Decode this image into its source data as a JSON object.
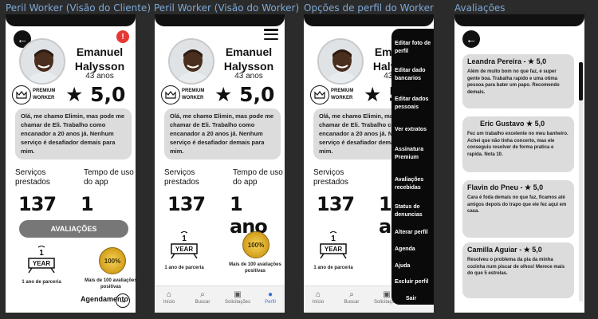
{
  "frame_labels": [
    "Peril Worker (Visão do Cliente)",
    "Peril Worker (Visão do Worker)",
    "Opções de perfil do Worker",
    "Avaliações"
  ],
  "profile": {
    "name_line1": "Emanuel",
    "name_line2": "Halysson",
    "age": "43 anos",
    "premium_line1": "PREMIUM",
    "premium_line2": "WORKER",
    "rating": "★ 5,0",
    "bio": "Olá, me chamo Elimin, mas pode me chamar de Eli. Trabalho como encanador a 20 anos já. Nenhum serviço é desafiador demais para mim.",
    "stats": {
      "services_label": "Serviços prestados",
      "services_value": "137",
      "time_label": "Tempo de uso do app",
      "time_value": "1 ano"
    },
    "badges": {
      "year_label": "1",
      "year_word": "YEAR",
      "year_caption": "1 ano de parceria",
      "hundred_label": "100%",
      "hundred_caption": "Mais de 100 avaliações positivas"
    }
  },
  "client_view": {
    "reviews_button": "AVALIAÇÕES",
    "schedule_label": "Agendamento",
    "arrow_icon": "→"
  },
  "nav": {
    "items": [
      {
        "label": "Início",
        "icon": "⌂"
      },
      {
        "label": "Buscar",
        "icon": "⌕"
      },
      {
        "label": "Solicitações",
        "icon": "▣"
      },
      {
        "label": "Perfil",
        "icon": "●"
      }
    ],
    "active_color": "#3b6fd1"
  },
  "menu": {
    "items": [
      "Editar foto de perfil",
      "Editar dado bancarios",
      "Editar dados pessoais",
      "Ver extratos",
      "Assinatura Premium",
      "Avaliações recebidas",
      "Status de denuncias",
      "Alterar perfil",
      "Agenda",
      "Ajuda",
      "Excluir perfil",
      "Sair"
    ]
  },
  "reviews": [
    {
      "name": "Leandra Pereira",
      "rating": "★ 5,0",
      "text": "Além de muito bom no que faz, é super gente boa. Trabalha rapido e uma otima pessoa para bater um papo. Recomendo demais."
    },
    {
      "name": "Eric Gustavo",
      "rating": "★ 5,0",
      "text": "Fez um trabalho excelente no meu banheiro. Achei que não tinha concerto, mas ele conseguiu resolver de forma pratica e rapida. Nota 10."
    },
    {
      "name": "Flavin do Pneu",
      "rating": "★ 5,0",
      "text": "Cara é foda demais no que faz, ficamos até amigos depois do trapo que ele fez aqui em casa."
    },
    {
      "name": "Camilla Aguiar",
      "rating": "★ 5,0",
      "text": "Resolveu o problema da pia da minha cozinha num piscar de olhos! Merece mais do que 5 estrelas."
    }
  ],
  "colors": {
    "frame_label": "#7fa9d6",
    "report": "#e53935",
    "card": "#dcdcdc",
    "button": "#777777"
  }
}
